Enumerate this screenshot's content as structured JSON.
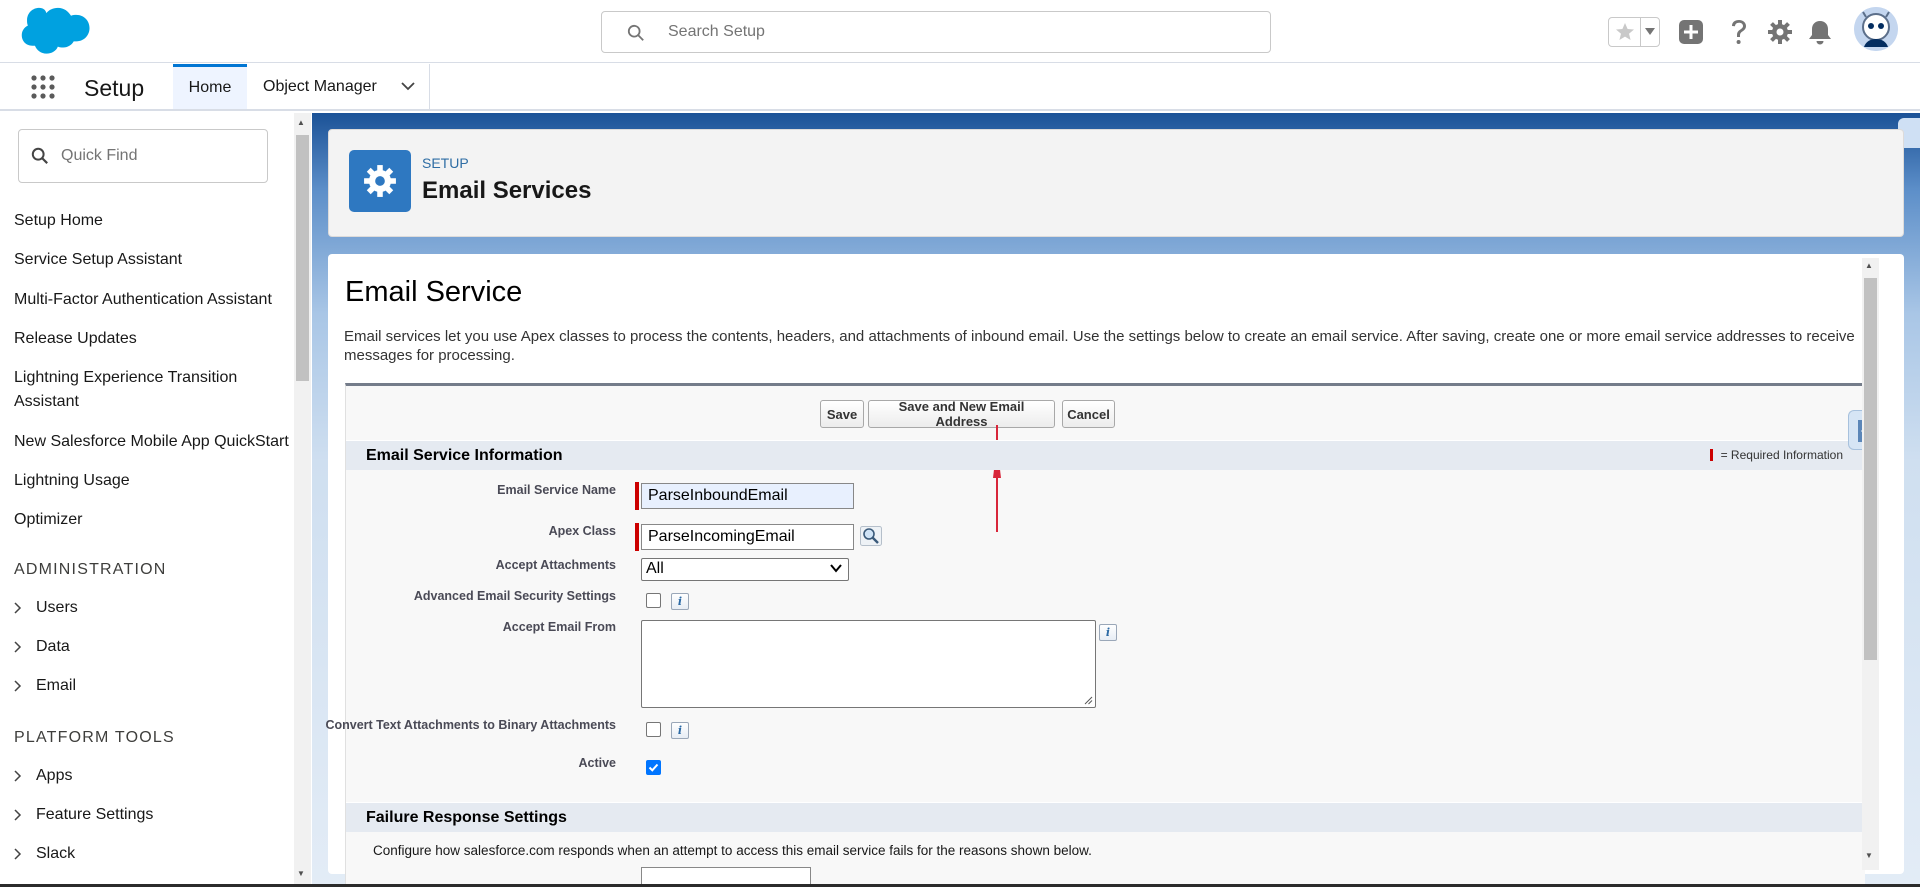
{
  "header": {
    "search_placeholder": "Search Setup",
    "icons": [
      "favorites-star-icon",
      "favorites-dropdown-icon",
      "global-actions-plus-icon",
      "help-icon",
      "setup-gear-icon",
      "notifications-bell-icon",
      "user-avatar"
    ]
  },
  "nav": {
    "app_name": "Setup",
    "tabs": [
      {
        "label": "Home",
        "active": true
      },
      {
        "label": "Object Manager",
        "active": false
      }
    ]
  },
  "sidebar": {
    "quickfind_placeholder": "Quick Find",
    "links": [
      "Setup Home",
      "Service Setup Assistant",
      "Multi-Factor Authentication Assistant",
      "Release Updates",
      "Lightning Experience Transition Assistant",
      "New Salesforce Mobile App QuickStart",
      "Lightning Usage",
      "Optimizer"
    ],
    "sections": [
      {
        "heading": "ADMINISTRATION",
        "items": [
          "Users",
          "Data",
          "Email"
        ]
      },
      {
        "heading": "PLATFORM TOOLS",
        "items": [
          "Apps",
          "Feature Settings",
          "Slack"
        ]
      }
    ]
  },
  "page_header": {
    "eyebrow": "SETUP",
    "title": "Email Services"
  },
  "content": {
    "title": "Email Service",
    "description": "Email services let you use Apex classes to process the contents, headers, and attachments of inbound email. Use the settings below to create an email service. After saving, create one or more email service addresses to receive messages for processing.",
    "buttons": {
      "save": "Save",
      "save_new": "Save and New Email Address",
      "cancel": "Cancel"
    },
    "section_info": {
      "title": "Email Service Information",
      "required_legend": "= Required Information"
    },
    "fields": {
      "service_name_label": "Email Service Name",
      "service_name_value": "ParseInboundEmail",
      "apex_class_label": "Apex Class",
      "apex_class_value": "ParseIncomingEmail",
      "accept_attachments_label": "Accept Attachments",
      "accept_attachments_value": "All",
      "advanced_security_label": "Advanced Email Security Settings",
      "accept_from_label": "Accept Email From",
      "accept_from_value": "",
      "convert_text_label": "Convert Text Attachments to Binary Attachments",
      "active_label": "Active",
      "active_checked": true
    },
    "section_failure": {
      "title": "Failure Response Settings",
      "description": "Configure how salesforce.com responds when an attempt to access this email service fails for the reasons shown below."
    }
  },
  "colors": {
    "brand_blue": "#0176d3",
    "required_red": "#cc0000",
    "annotation_arrow": "#d8263a"
  }
}
